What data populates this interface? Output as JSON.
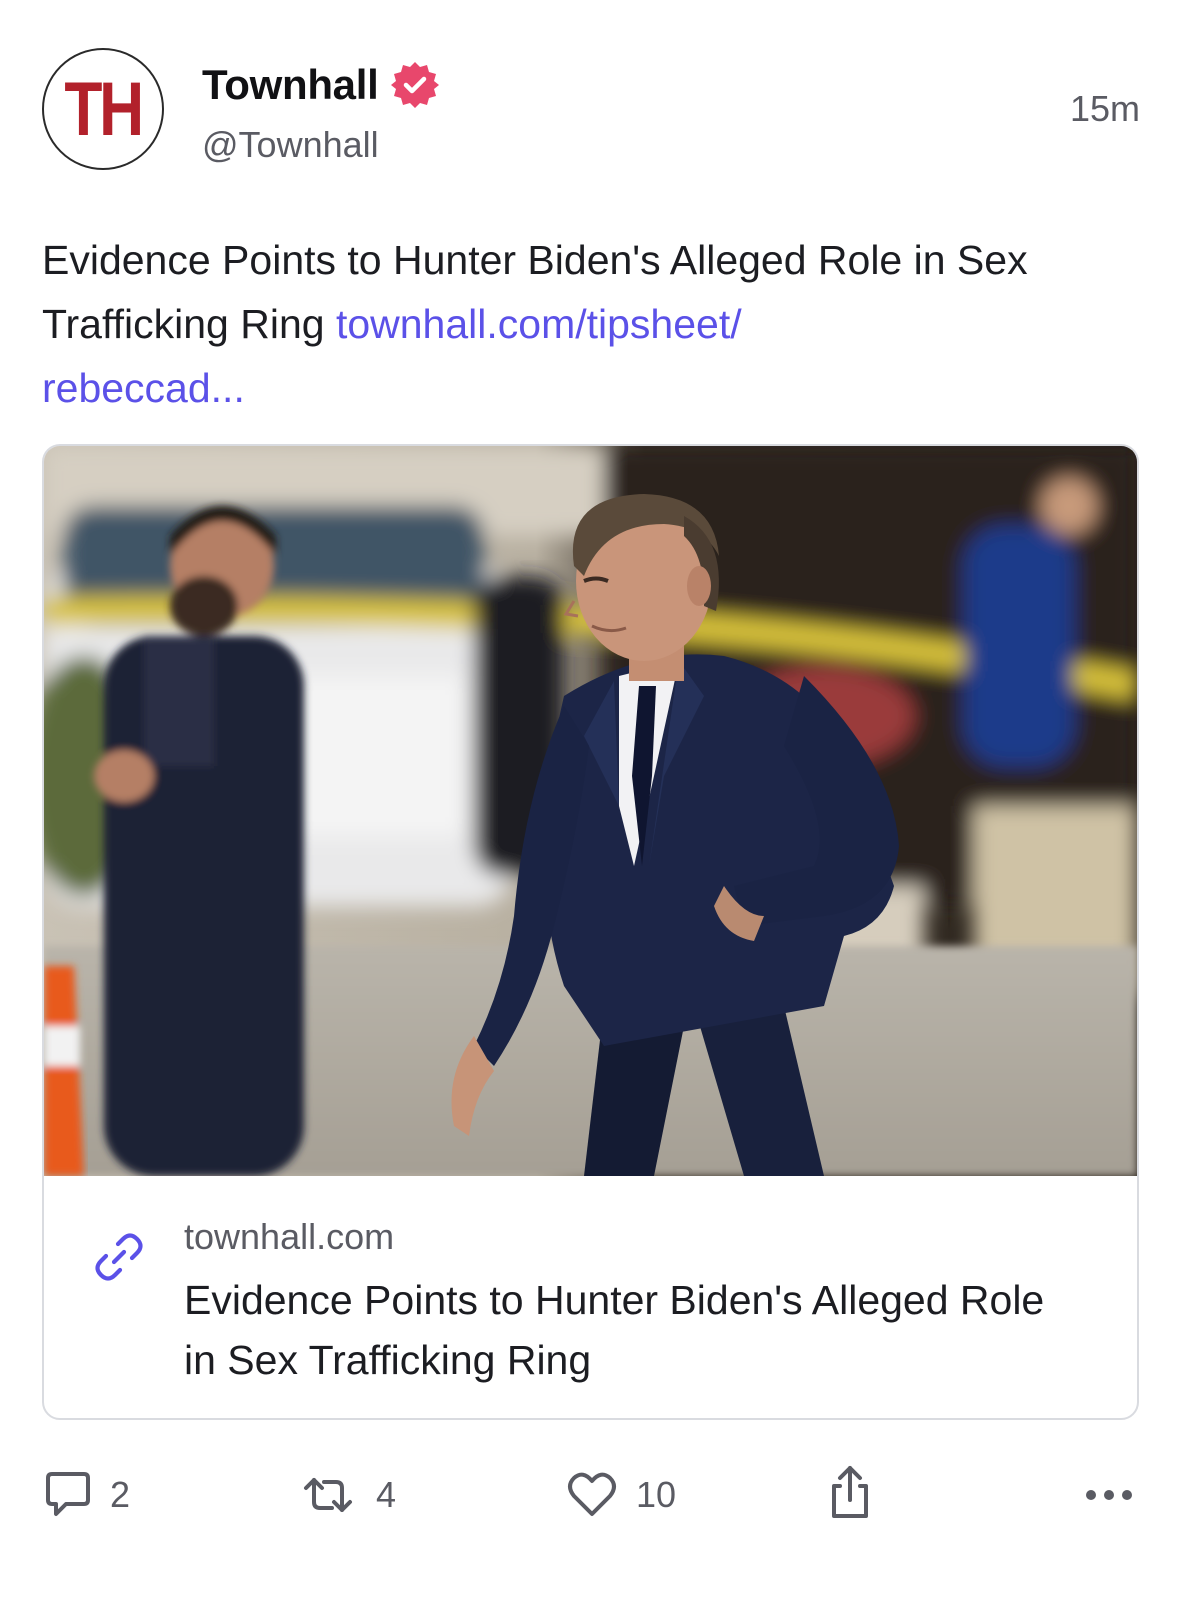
{
  "post": {
    "author": {
      "avatar_text": "TH",
      "display_name": "Townhall",
      "handle": "@Townhall",
      "verified": true,
      "avatar_color": "#b2212b"
    },
    "timestamp": "15m",
    "text": "Evidence Points to Hunter Biden's Alleged Role in Sex Trafficking Ring ",
    "link_text_line1": "townhall.com/tipsheet/",
    "link_text_line2": "rebeccad...",
    "link_color": "#5b51e8",
    "verified_badge_color": "#e8476c"
  },
  "link_card": {
    "image_icon": "photo-man-in-navy-suit-walking",
    "link_icon": "link-icon",
    "domain": "townhall.com",
    "title": "Evidence Points to Hunter Biden's Alleged Role in Sex Trafficking Ring"
  },
  "actions": {
    "reply": {
      "icon": "reply-icon",
      "count": "2"
    },
    "repost": {
      "icon": "repost-icon",
      "count": "4"
    },
    "like": {
      "icon": "heart-icon",
      "count": "10"
    },
    "share": {
      "icon": "share-icon"
    },
    "more": {
      "icon": "more-icon"
    }
  }
}
